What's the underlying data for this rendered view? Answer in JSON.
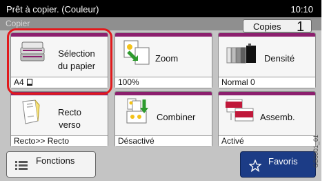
{
  "status_bar": {
    "message": "Prêt à copier. (Couleur)",
    "time": "10:10"
  },
  "sub_bar": {
    "title": "Copier",
    "copies_label": "Copies",
    "copies_count": "1"
  },
  "tiles": [
    {
      "label_line1": "Sélection",
      "label_line2": "du papier",
      "value": "A4",
      "value_icon": "portrait-page-icon"
    },
    {
      "label_line1": "Zoom",
      "label_line2": "",
      "value": "100%"
    },
    {
      "label_line1": "Densité",
      "label_line2": "",
      "value": "Normal 0"
    },
    {
      "label_line1": "Recto",
      "label_line2": "verso",
      "value": "Recto>> Recto"
    },
    {
      "label_line1": "Combiner",
      "label_line2": "",
      "value": "Désactivé"
    },
    {
      "label_line1": "Assemb.",
      "label_line2": "",
      "value": "Activé"
    }
  ],
  "bottom": {
    "functions_label": "Fonctions",
    "favorites_label": "Favoris"
  },
  "side_code": "GB0001_01",
  "colors": {
    "accent": "#8c1f6e",
    "highlight": "#e2191c",
    "favorites_bg": "#1c3c86",
    "status_bg": "#000000"
  },
  "icons": [
    "paper-stack-icon",
    "zoom-icon",
    "density-icon",
    "duplex-icon",
    "combine-icon",
    "collate-icon",
    "list-icon",
    "star-icon"
  ]
}
